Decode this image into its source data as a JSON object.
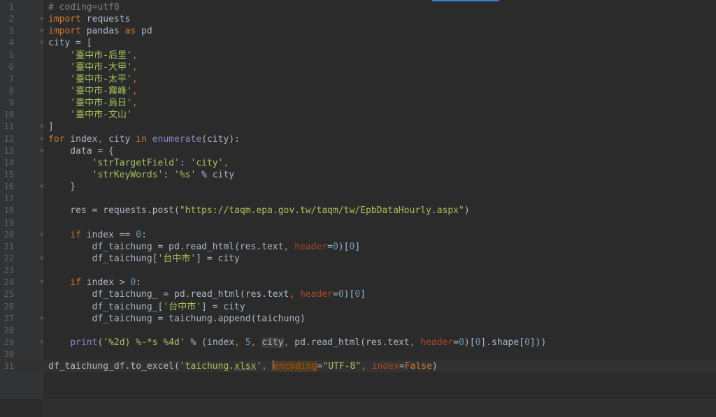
{
  "editor": {
    "lines": [
      {
        "n": "1",
        "t": [
          {
            "c": "c",
            "v": "# coding=utf8"
          }
        ],
        "fold": ""
      },
      {
        "n": "2",
        "t": [
          {
            "c": "k",
            "v": "import"
          },
          {
            "c": "",
            "v": " requests"
          }
        ],
        "fold": "⊖"
      },
      {
        "n": "3",
        "t": [
          {
            "c": "k",
            "v": "import"
          },
          {
            "c": "",
            "v": " pandas "
          },
          {
            "c": "k",
            "v": "as"
          },
          {
            "c": "",
            "v": " pd"
          }
        ],
        "fold": "⊖"
      },
      {
        "n": "4",
        "t": [
          {
            "c": "",
            "v": "city = ["
          }
        ],
        "fold": "⊖"
      },
      {
        "n": "5",
        "t": [
          {
            "c": "",
            "v": "    "
          },
          {
            "c": "s2",
            "v": "'臺中市-后里'"
          },
          {
            "c": "k",
            "v": ","
          }
        ],
        "fold": ""
      },
      {
        "n": "6",
        "t": [
          {
            "c": "",
            "v": "    "
          },
          {
            "c": "s2",
            "v": "'臺中市-大甲'"
          },
          {
            "c": "k",
            "v": ","
          }
        ],
        "fold": ""
      },
      {
        "n": "7",
        "t": [
          {
            "c": "",
            "v": "    "
          },
          {
            "c": "s2",
            "v": "'臺中市-太平'"
          },
          {
            "c": "k",
            "v": ","
          }
        ],
        "fold": ""
      },
      {
        "n": "8",
        "t": [
          {
            "c": "",
            "v": "    "
          },
          {
            "c": "s2",
            "v": "'臺中市-霧峰'"
          },
          {
            "c": "k",
            "v": ","
          }
        ],
        "fold": ""
      },
      {
        "n": "9",
        "t": [
          {
            "c": "",
            "v": "    "
          },
          {
            "c": "s2",
            "v": "'臺中市-烏日'"
          },
          {
            "c": "k",
            "v": ","
          }
        ],
        "fold": ""
      },
      {
        "n": "10",
        "t": [
          {
            "c": "",
            "v": "    "
          },
          {
            "c": "s2",
            "v": "'臺中市-文山'"
          }
        ],
        "fold": ""
      },
      {
        "n": "11",
        "t": [
          {
            "c": "",
            "v": "]"
          }
        ],
        "fold": "⊖"
      },
      {
        "n": "12",
        "t": [
          {
            "c": "k",
            "v": "for"
          },
          {
            "c": "",
            "v": " index"
          },
          {
            "c": "k",
            "v": ","
          },
          {
            "c": "",
            "v": " city "
          },
          {
            "c": "k",
            "v": "in"
          },
          {
            "c": "",
            "v": " "
          },
          {
            "c": "b",
            "v": "enumerate"
          },
          {
            "c": "",
            "v": "(city):"
          }
        ],
        "fold": "⊖"
      },
      {
        "n": "13",
        "t": [
          {
            "c": "",
            "v": "    data = {"
          }
        ],
        "fold": "⊖"
      },
      {
        "n": "14",
        "t": [
          {
            "c": "",
            "v": "        "
          },
          {
            "c": "s2",
            "v": "'strTargetField'"
          },
          {
            "c": "",
            "v": ": "
          },
          {
            "c": "s2",
            "v": "'city'"
          },
          {
            "c": "k",
            "v": ","
          }
        ],
        "fold": ""
      },
      {
        "n": "15",
        "t": [
          {
            "c": "",
            "v": "        "
          },
          {
            "c": "s2",
            "v": "'strKeyWords'"
          },
          {
            "c": "",
            "v": ": "
          },
          {
            "c": "s2",
            "v": "'%s'"
          },
          {
            "c": "",
            "v": " % city"
          }
        ],
        "fold": ""
      },
      {
        "n": "16",
        "t": [
          {
            "c": "",
            "v": "    }"
          }
        ],
        "fold": "⊖"
      },
      {
        "n": "17",
        "t": [],
        "fold": ""
      },
      {
        "n": "18",
        "t": [
          {
            "c": "",
            "v": "    res = requests.post("
          },
          {
            "c": "s2",
            "v": "\"https://taqm.epa.gov.tw/taqm/tw/EpbDataHourly.aspx\""
          },
          {
            "c": "",
            "v": ")"
          }
        ],
        "fold": ""
      },
      {
        "n": "19",
        "t": [],
        "fold": ""
      },
      {
        "n": "20",
        "t": [
          {
            "c": "",
            "v": "    "
          },
          {
            "c": "k",
            "v": "if"
          },
          {
            "c": "",
            "v": " index == "
          },
          {
            "c": "n",
            "v": "0"
          },
          {
            "c": "",
            "v": ":"
          }
        ],
        "fold": "⊖"
      },
      {
        "n": "21",
        "t": [
          {
            "c": "",
            "v": "        df_taichung = pd.read_html(res.text"
          },
          {
            "c": "k",
            "v": ", "
          },
          {
            "c": "p",
            "v": "header"
          },
          {
            "c": "",
            "v": "="
          },
          {
            "c": "n",
            "v": "0"
          },
          {
            "c": "",
            "v": ")["
          },
          {
            "c": "n",
            "v": "0"
          },
          {
            "c": "",
            "v": "]"
          }
        ],
        "fold": ""
      },
      {
        "n": "22",
        "t": [
          {
            "c": "",
            "v": "        df_taichung["
          },
          {
            "c": "s2",
            "v": "'台中市'"
          },
          {
            "c": "",
            "v": "] = city"
          }
        ],
        "fold": "⊖"
      },
      {
        "n": "23",
        "t": [],
        "fold": ""
      },
      {
        "n": "24",
        "t": [
          {
            "c": "",
            "v": "    "
          },
          {
            "c": "k",
            "v": "if"
          },
          {
            "c": "",
            "v": " index > "
          },
          {
            "c": "n",
            "v": "0"
          },
          {
            "c": "",
            "v": ":"
          }
        ],
        "fold": "⊖"
      },
      {
        "n": "25",
        "t": [
          {
            "c": "",
            "v": "        df_taichung_ = pd.read_html(res.text"
          },
          {
            "c": "k",
            "v": ", "
          },
          {
            "c": "p",
            "v": "header"
          },
          {
            "c": "",
            "v": "="
          },
          {
            "c": "n",
            "v": "0"
          },
          {
            "c": "",
            "v": ")["
          },
          {
            "c": "n",
            "v": "0"
          },
          {
            "c": "",
            "v": "]"
          }
        ],
        "fold": ""
      },
      {
        "n": "26",
        "t": [
          {
            "c": "",
            "v": "        df_taichung_["
          },
          {
            "c": "s2",
            "v": "'台中市'"
          },
          {
            "c": "",
            "v": "] = city"
          }
        ],
        "fold": ""
      },
      {
        "n": "27",
        "t": [
          {
            "c": "",
            "v": "        df_taichung = taichung.append(taichung)"
          }
        ],
        "fold": "⊖"
      },
      {
        "n": "28",
        "t": [],
        "fold": ""
      },
      {
        "n": "29",
        "t": [
          {
            "c": "",
            "v": "    "
          },
          {
            "c": "b",
            "v": "print"
          },
          {
            "c": "",
            "v": "("
          },
          {
            "c": "s2",
            "v": "'%2d) %-*s %4d'"
          },
          {
            "c": "",
            "v": " % (index"
          },
          {
            "c": "k",
            "v": ", "
          },
          {
            "c": "n",
            "v": "5"
          },
          {
            "c": "k",
            "v": ", "
          },
          {
            "c": "hl",
            "v": "city"
          },
          {
            "c": "k",
            "v": ", "
          },
          {
            "c": "",
            "v": "pd.read_html(res.text"
          },
          {
            "c": "k",
            "v": ", "
          },
          {
            "c": "p",
            "v": "header"
          },
          {
            "c": "",
            "v": "="
          },
          {
            "c": "n",
            "v": "0"
          },
          {
            "c": "",
            "v": ")["
          },
          {
            "c": "n",
            "v": "0"
          },
          {
            "c": "",
            "v": "].shape["
          },
          {
            "c": "n",
            "v": "0"
          },
          {
            "c": "",
            "v": "]))"
          }
        ],
        "fold": "⊖"
      },
      {
        "n": "30",
        "t": [],
        "fold": ""
      },
      {
        "n": "31",
        "t": [
          {
            "c": "",
            "v": "df_taichung_df.to_excel("
          },
          {
            "c": "s2",
            "v": "'taichung."
          },
          {
            "c": "s2 u",
            "v": "xlsx"
          },
          {
            "c": "s2",
            "v": "'"
          },
          {
            "c": "k",
            "v": ", "
          },
          {
            "c": "caret",
            "v": ""
          },
          {
            "c": "p warn",
            "v": "encoding"
          },
          {
            "c": "",
            "v": "="
          },
          {
            "c": "s2",
            "v": "\"UTF-8\""
          },
          {
            "c": "k",
            "v": ", "
          },
          {
            "c": "p",
            "v": "index"
          },
          {
            "c": "",
            "v": "="
          },
          {
            "c": "k",
            "v": "False"
          },
          {
            "c": "",
            "v": ")"
          }
        ],
        "fold": ""
      }
    ]
  }
}
